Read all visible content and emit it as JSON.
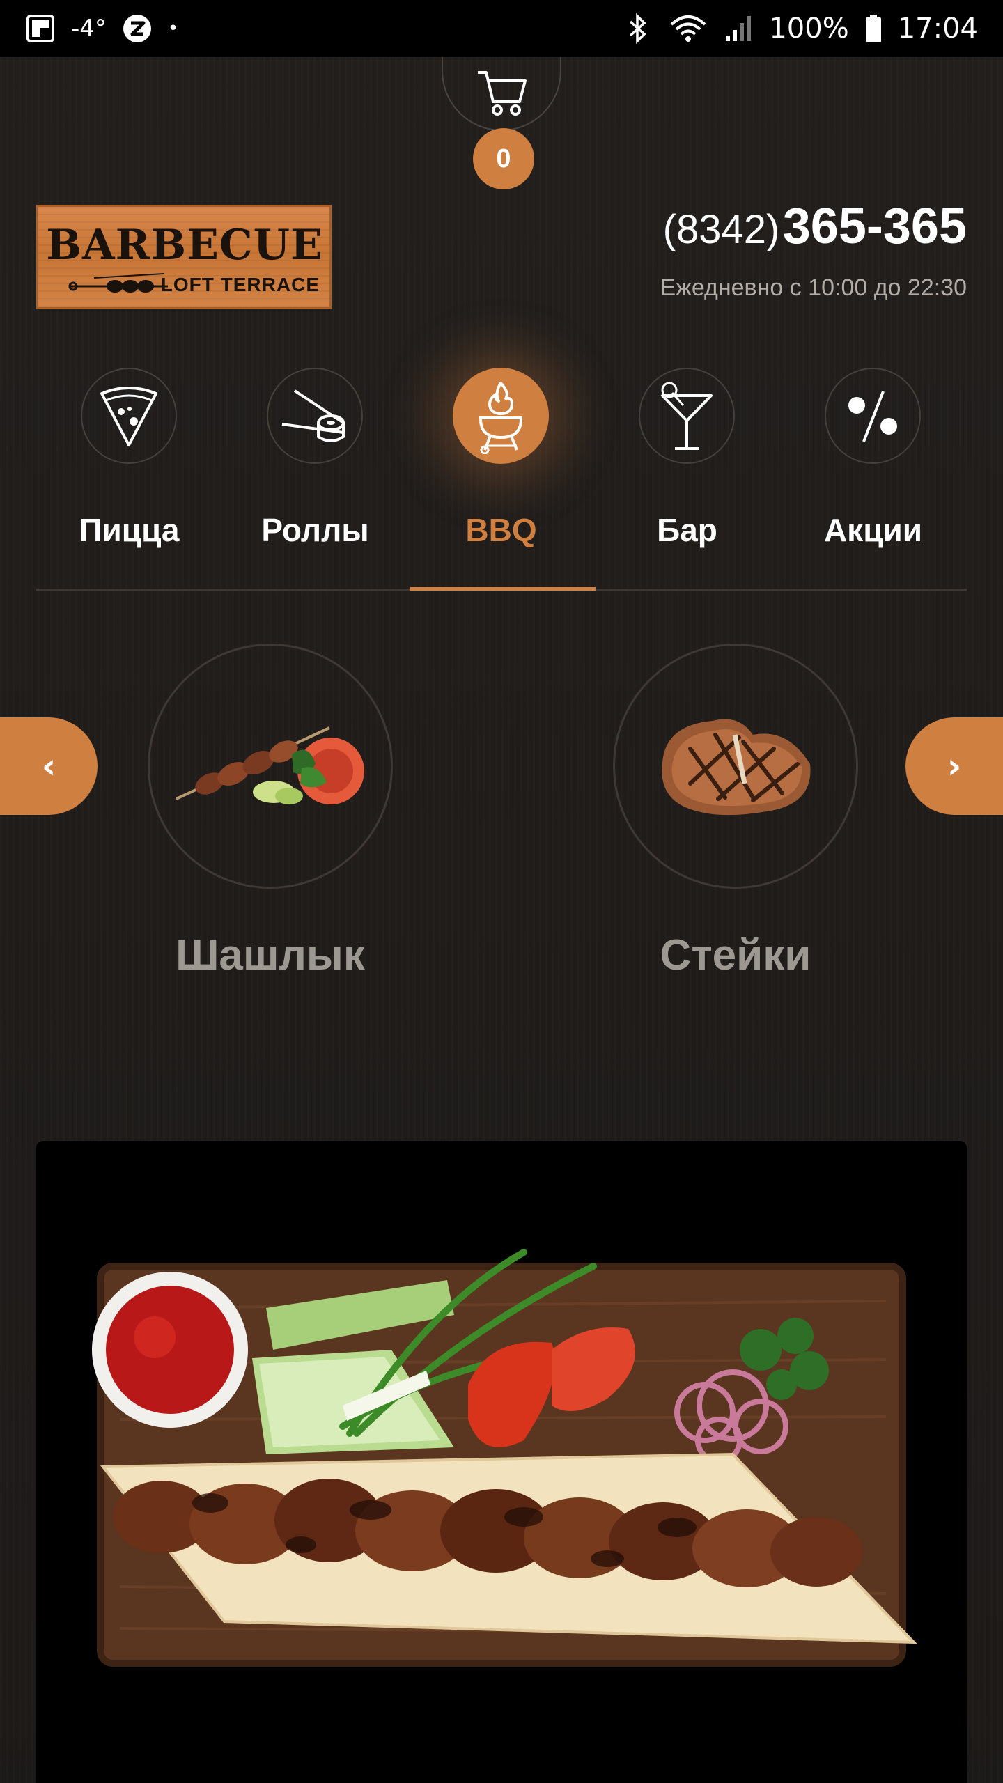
{
  "status_bar": {
    "temperature": "-4°",
    "dot": "•",
    "battery": "100%",
    "time": "17:04",
    "icons": [
      "flipboard-icon",
      "z-app-icon",
      "bluetooth-icon",
      "wifi-icon",
      "signal-icon",
      "battery-icon"
    ]
  },
  "cart": {
    "count": "0",
    "icon": "cart-icon"
  },
  "logo": {
    "title": "BARBECUE",
    "subtitle": "LOFT TERRACE"
  },
  "contact": {
    "phone_code": "(8342)",
    "phone_number": "365-365",
    "hours": "Ежедневно с 10:00 до 22:30"
  },
  "categories": [
    {
      "label": "Пицца",
      "icon": "pizza-icon",
      "active": false
    },
    {
      "label": "Роллы",
      "icon": "rolls-icon",
      "active": false
    },
    {
      "label": "BBQ",
      "icon": "grill-icon",
      "active": true
    },
    {
      "label": "Бар",
      "icon": "cocktail-icon",
      "active": false
    },
    {
      "label": "Акции",
      "icon": "percent-icon",
      "active": false
    }
  ],
  "subcategories": [
    {
      "label": "Шашлык",
      "icon": "shashlik-image"
    },
    {
      "label": "Стейки",
      "icon": "steak-image"
    }
  ],
  "carousel": {
    "prev": "‹",
    "next": "›"
  },
  "colors": {
    "accent": "#cf7f3f",
    "background": "#1f1c1a",
    "muted_text": "#9e9892"
  }
}
